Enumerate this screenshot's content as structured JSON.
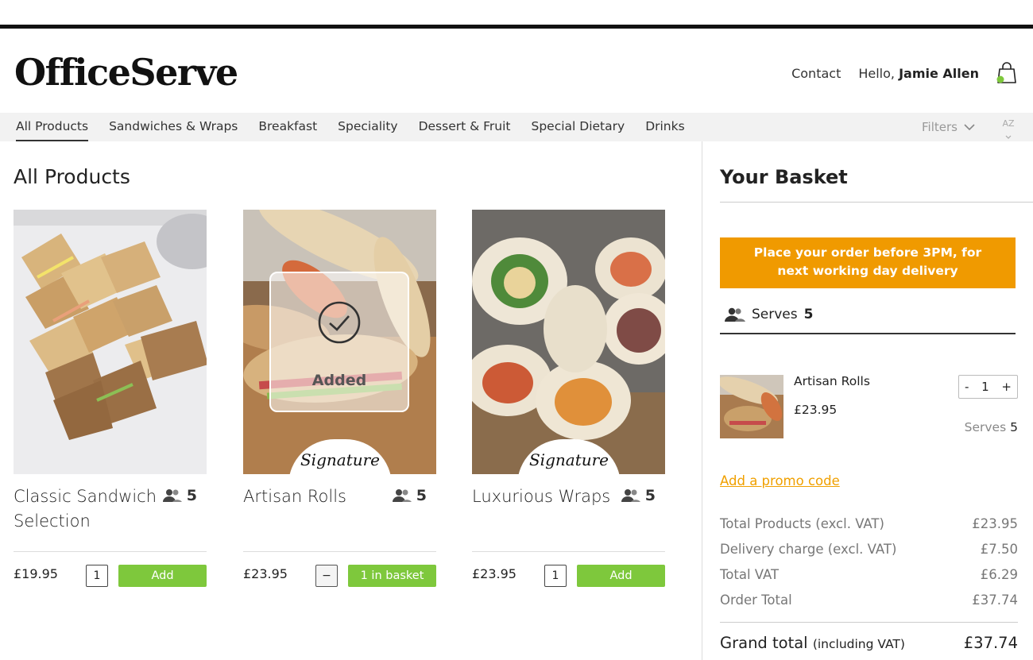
{
  "brand": {
    "logo": "OfficeServe"
  },
  "header": {
    "contact_label": "Contact",
    "greeting": "Hello,",
    "user_name": "Jamie Allen",
    "cart_icon": "shopping-bag-icon",
    "cart_indicator_color": "#7ec83c"
  },
  "nav": {
    "items": [
      {
        "label": "All Products",
        "active": true
      },
      {
        "label": "Sandwiches & Wraps"
      },
      {
        "label": "Breakfast"
      },
      {
        "label": "Speciality"
      },
      {
        "label": "Dessert & Fruit"
      },
      {
        "label": "Special Dietary"
      },
      {
        "label": "Drinks"
      }
    ],
    "filters_label": "Filters",
    "sort_label_top": "A",
    "sort_label_bottom": "Z"
  },
  "main": {
    "title": "All Products",
    "products": [
      {
        "name": "Classic Sandwich Selection",
        "serves": "5",
        "price": "£19.95",
        "qty": "1",
        "button": "Add",
        "signature": false,
        "added": false
      },
      {
        "name": "Artisan Rolls",
        "serves": "5",
        "price": "£23.95",
        "qty_control": "−",
        "button": "1 in basket",
        "signature": true,
        "signature_text": "Signature",
        "added": true,
        "added_text": "Added"
      },
      {
        "name": "Luxurious Wraps",
        "serves": "5",
        "price": "£23.95",
        "qty": "1",
        "button": "Add",
        "signature": true,
        "signature_text": "Signature",
        "added": false
      }
    ]
  },
  "basket": {
    "title": "Your Basket",
    "notice_line1": "Place your order before 3PM, for",
    "notice_line2": "next working day delivery",
    "serves_label": "Serves",
    "serves_value": "5",
    "item": {
      "name": "Artisan Rolls",
      "price": "£23.95",
      "minus": "-",
      "qty": "1",
      "plus": "+",
      "serves_label": "Serves",
      "serves_value": "5"
    },
    "promo_label": "Add a promo code",
    "totals": [
      {
        "label": "Total Products (excl. VAT)",
        "value": "£23.95"
      },
      {
        "label": "Delivery charge (excl. VAT)",
        "value": "£7.50"
      },
      {
        "label": "Total VAT",
        "value": "£6.29"
      },
      {
        "label": "Order Total",
        "value": "£37.74"
      }
    ],
    "grand_label": "Grand total",
    "grand_sublabel": "(including VAT)",
    "grand_value": "£37.74"
  },
  "colors": {
    "accent_green": "#7ec83c",
    "notice_orange": "#f09a00",
    "promo_link": "#f0a000"
  }
}
